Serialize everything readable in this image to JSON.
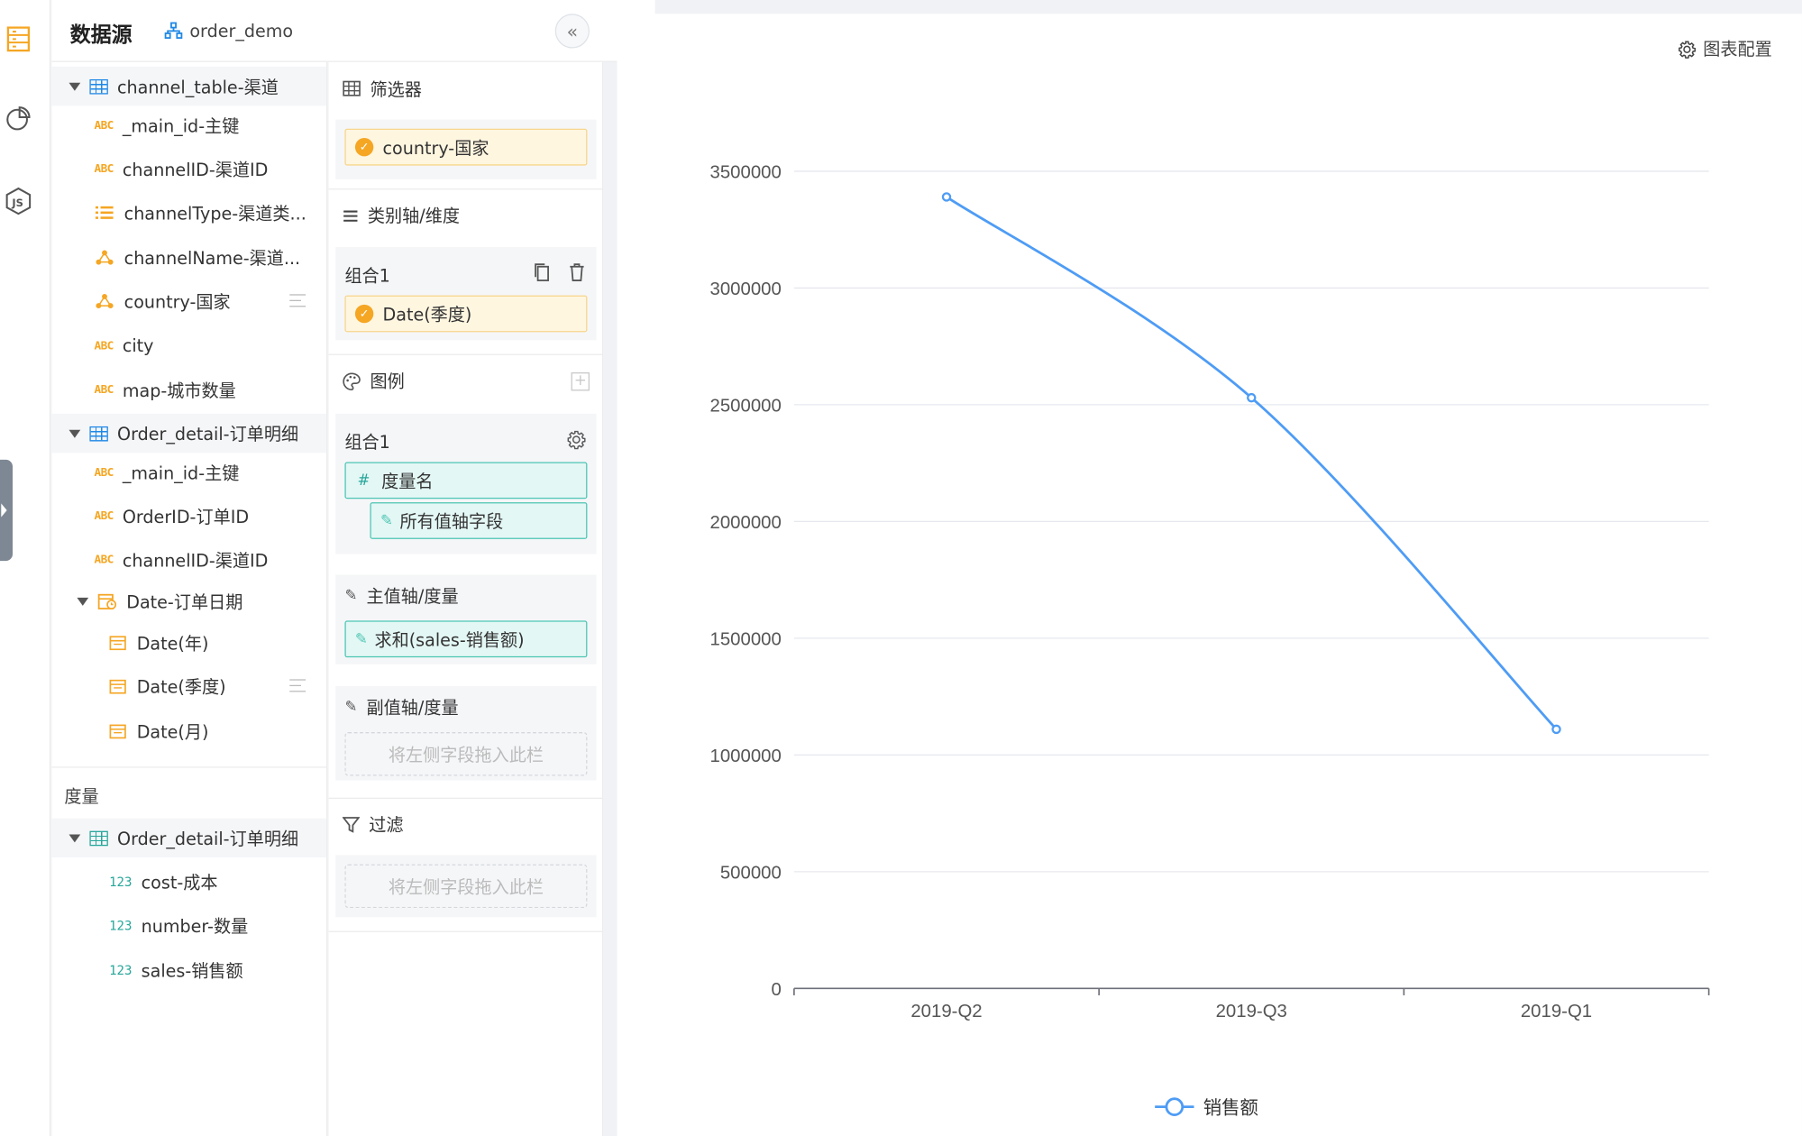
{
  "datasource": {
    "title": "数据源",
    "db_name": "order_demo"
  },
  "dimension_tree": [
    {
      "kind": "table",
      "label": "channel_table-渠道"
    },
    {
      "kind": "abc",
      "label": "_main_id-主键"
    },
    {
      "kind": "abc",
      "label": "channelID-渠道ID"
    },
    {
      "kind": "list",
      "label": "channelType-渠道类..."
    },
    {
      "kind": "geo",
      "label": "channelName-渠道..."
    },
    {
      "kind": "geo",
      "label": "country-国家"
    },
    {
      "kind": "abc",
      "label": "city"
    },
    {
      "kind": "abc",
      "label": "map-城市数量"
    },
    {
      "kind": "table",
      "label": "Order_detail-订单明细"
    },
    {
      "kind": "abc",
      "label": "_main_id-主键"
    },
    {
      "kind": "abc",
      "label": "OrderID-订单ID"
    },
    {
      "kind": "abc",
      "label": "channelID-渠道ID"
    },
    {
      "kind": "date-group",
      "label": "Date-订单日期"
    },
    {
      "kind": "date",
      "label": "Date(年)"
    },
    {
      "kind": "date",
      "label": "Date(季度)"
    },
    {
      "kind": "date",
      "label": "Date(月)"
    }
  ],
  "measures": {
    "section_label": "度量",
    "table": "Order_detail-订单明细",
    "items": [
      "cost-成本",
      "number-数量",
      "sales-销售额"
    ]
  },
  "config": {
    "filter_title": "筛选器",
    "filter_chip": "country-国家",
    "category_title": "类别轴/维度",
    "category_group": "组合1",
    "category_chip": "Date(季度)",
    "legend_title": "图例",
    "legend_group": "组合1",
    "legend_chip1": "度量名",
    "legend_chip2": "所有值轴字段",
    "main_axis_title": "主值轴/度量",
    "main_axis_chip": "求和(sales-销售额)",
    "sub_axis_title": "副值轴/度量",
    "sub_axis_drop": "将左侧字段拖入此栏",
    "filter2_title": "过滤",
    "filter2_drop": "将左侧字段拖入此栏"
  },
  "chart_config_label": "图表配置",
  "chart_data": {
    "type": "line",
    "categories": [
      "2019-Q2",
      "2019-Q3",
      "2019-Q1"
    ],
    "series": [
      {
        "name": "销售额",
        "values": [
          3390000,
          2530000,
          1110000
        ]
      }
    ],
    "yticks": [
      "0",
      "500000",
      "1000000",
      "1500000",
      "2000000",
      "2500000",
      "3000000",
      "3500000"
    ],
    "ylim": [
      0,
      3500000
    ],
    "smooth": true,
    "color": "#4e9cf5",
    "grid": "horizontal",
    "legend_position": "bottom-center"
  }
}
